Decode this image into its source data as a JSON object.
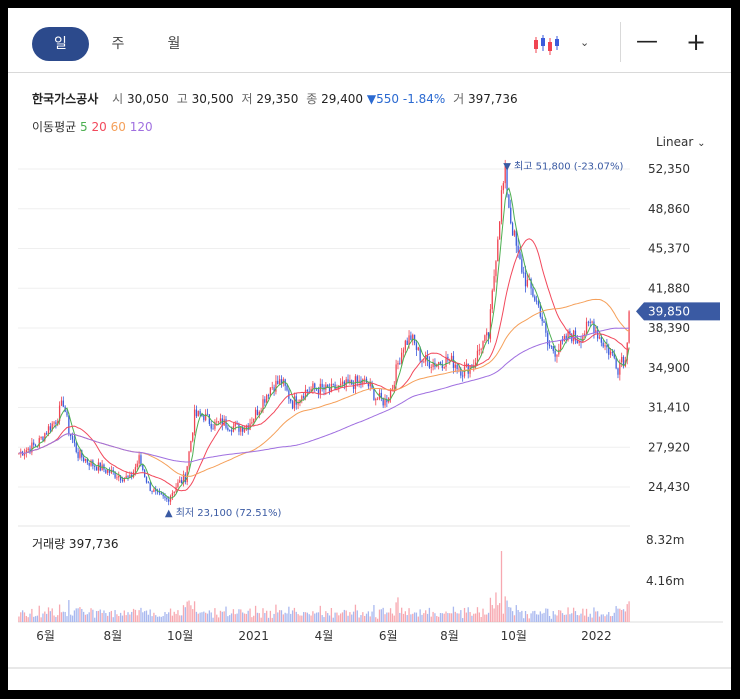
{
  "tabs": [
    "일",
    "주",
    "월"
  ],
  "stock": {
    "name": "한국가스공사",
    "open_label": "시",
    "open": "30,050",
    "high_label": "고",
    "high": "30,500",
    "low_label": "저",
    "low": "29,350",
    "close_label": "종",
    "close": "29,400",
    "change": "▼550",
    "change_pct": "-1.84%",
    "vol_label": "거",
    "volume": "397,736"
  },
  "ma": {
    "label": "이동평균",
    "periods": [
      "5",
      "20",
      "60",
      "120"
    ],
    "colors": [
      "#4caf50",
      "#f2495c",
      "#f5a05a",
      "#a070e0"
    ]
  },
  "scale_label": "Linear",
  "colors": {
    "up": "#f04452",
    "down": "#3b5bdb",
    "accent": "#2c4a8c",
    "price_tag": "#3a5aa3"
  },
  "chart_data": {
    "type": "candlestick",
    "y_ticks": [
      "52,350",
      "48,860",
      "45,370",
      "41,880",
      "38,390",
      "34,900",
      "31,410",
      "27,920",
      "24,430"
    ],
    "y_tick_values": [
      52350,
      48860,
      45370,
      41880,
      38390,
      34900,
      31410,
      27920,
      24430
    ],
    "x_ticks": [
      "6월",
      "8월",
      "10월",
      "2021",
      "4월",
      "6월",
      "8월",
      "10월",
      "2022"
    ],
    "current_price": "39,850",
    "max_annotation": "▼ 최고 51,800 (-23.07%)",
    "min_annotation": "▲ 최저 23,100 (72.51%)",
    "volume_label": "거래량",
    "volume_value": "397,736",
    "volume_ticks": [
      "8.32m",
      "4.16m"
    ],
    "volume_tick_values": [
      8320000,
      4160000
    ],
    "price_anchors": [
      [
        0,
        27400
      ],
      [
        10,
        28200
      ],
      [
        15,
        29400
      ],
      [
        20,
        30300
      ],
      [
        24,
        31900
      ],
      [
        27,
        29400
      ],
      [
        32,
        27300
      ],
      [
        40,
        26400
      ],
      [
        50,
        25700
      ],
      [
        60,
        25100
      ],
      [
        65,
        26900
      ],
      [
        70,
        24600
      ],
      [
        75,
        23600
      ],
      [
        80,
        23300
      ],
      [
        85,
        24500
      ],
      [
        90,
        25300
      ],
      [
        95,
        30700
      ],
      [
        100,
        30700
      ],
      [
        105,
        29900
      ],
      [
        110,
        30100
      ],
      [
        118,
        29600
      ],
      [
        124,
        29900
      ],
      [
        130,
        31400
      ],
      [
        136,
        33200
      ],
      [
        142,
        33700
      ],
      [
        148,
        31800
      ],
      [
        154,
        32800
      ],
      [
        160,
        33100
      ],
      [
        168,
        32900
      ],
      [
        175,
        33200
      ],
      [
        182,
        33600
      ],
      [
        188,
        33600
      ],
      [
        193,
        32300
      ],
      [
        198,
        31900
      ],
      [
        202,
        33300
      ],
      [
        205,
        35300
      ],
      [
        208,
        36900
      ],
      [
        212,
        37600
      ],
      [
        218,
        35600
      ],
      [
        225,
        35300
      ],
      [
        232,
        35600
      ],
      [
        236,
        35300
      ],
      [
        240,
        34600
      ],
      [
        246,
        35300
      ],
      [
        250,
        36900
      ],
      [
        254,
        37600
      ],
      [
        258,
        44900
      ],
      [
        261,
        50100
      ],
      [
        263,
        51800
      ],
      [
        266,
        47900
      ],
      [
        270,
        44600
      ],
      [
        274,
        42600
      ],
      [
        278,
        41400
      ],
      [
        282,
        39900
      ],
      [
        286,
        36900
      ],
      [
        290,
        36400
      ],
      [
        294,
        36900
      ],
      [
        298,
        37900
      ],
      [
        302,
        37400
      ],
      [
        306,
        38100
      ],
      [
        310,
        38900
      ],
      [
        314,
        37600
      ],
      [
        318,
        36600
      ],
      [
        322,
        35800
      ],
      [
        324,
        34900
      ],
      [
        326,
        35900
      ],
      [
        328,
        35400
      ],
      [
        330,
        39850
      ]
    ]
  }
}
